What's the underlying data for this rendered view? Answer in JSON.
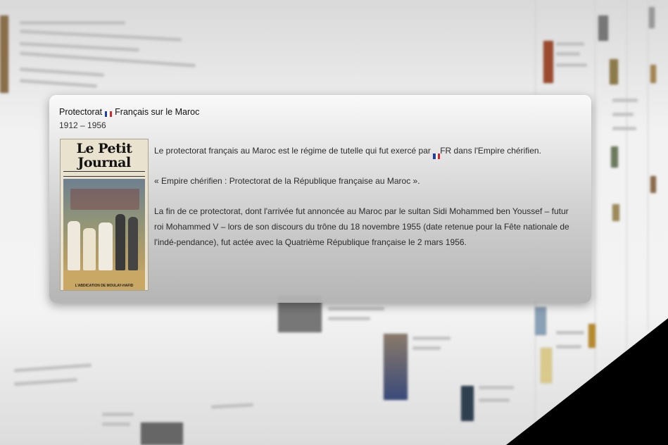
{
  "popup": {
    "title_before_flag": "Protectorat",
    "title_after_flag": "Français sur le Maroc",
    "years": "1912 – 1956",
    "image_masthead": "Le Petit Journal",
    "image_caption": "L'ABDICATION DE MOULAY-HAFID",
    "paragraph_1_before_flag": "Le protectorat français au Maroc est le régime de tutelle qui fut exercé par",
    "paragraph_1_after_flag": "FR dans l'Empire chérifien.",
    "paragraph_2": "« Empire chérifien : Protectorat de la République française au Maroc ».",
    "paragraph_3": "La fin de ce protectorat, dont l'arrivée fut annoncée au Maroc par le sultan Sidi Mohammed ben Youssef – futur roi Mohammed V – lors de son discours du trône du 18 novembre 1955 (date retenue pour la Fête nationale de l'indé-pendance), fut actée avec la Quatrième République française le 2 mars 1956."
  },
  "icons": {
    "flag": "france-flag-icon"
  },
  "colors": {
    "flag_blue": "#1f3fa8",
    "flag_white": "#ffffff",
    "flag_red": "#d6262b"
  }
}
